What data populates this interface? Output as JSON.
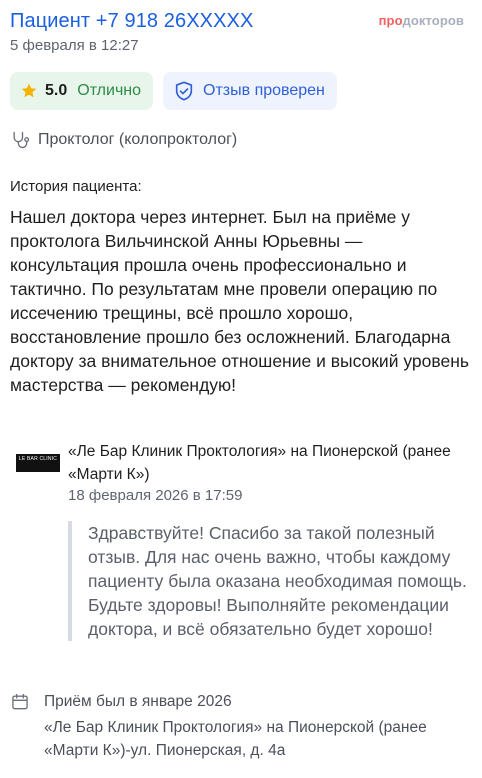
{
  "header": {
    "patient_title": "Пациент +7 918 26XXXXX",
    "date": "5 февраля в 12:27",
    "logo_pro": "про",
    "logo_doc": "докторов"
  },
  "badges": {
    "rating_score": "5.0",
    "rating_word": "Отлично",
    "verified_label": "Отзыв проверен"
  },
  "specialty": "Проктолог (колопроктолог)",
  "story": {
    "heading": "История пациента:",
    "body": "Нашел доктора через интернет. Был на приёме у проктолога Вильчинской Анны Юрьевны — консультация прошла очень профессионально и тактично. По результатам мне провели операцию по иссечению трещины, всё прошло хорошо, восстановление прошло без осложнений. Благодарна доктору за внимательное отношение и высокий уровень мастерства — рекомендую!"
  },
  "clinic": {
    "logo_text": "LE BAR CLINIC",
    "name": "«Ле Бар Клиник Проктология» на Пионерской (ранее «Марти К»)",
    "reply_date": "18 февраля 2026 в 17:59",
    "reply_text": "Здравствуйте! Спасибо за такой полезный отзыв. Для нас очень важно, чтобы каждому пациенту была оказана необходимая помощь. Будьте здоровы! Выполняйте рекомендации доктора, и всё обязательно будет хорошо!"
  },
  "visit": {
    "when": "Приём был в январе 2026",
    "address": "«Ле Бар Клиник Проктология» на Пионерской (ранее «Марти К»)-ул. Пионерская, д. 4а"
  },
  "colors": {
    "accent_blue": "#1a5fe0",
    "rating_green": "#2e8b49",
    "star_yellow": "#f5b400",
    "logo_red": "#f3625f"
  }
}
